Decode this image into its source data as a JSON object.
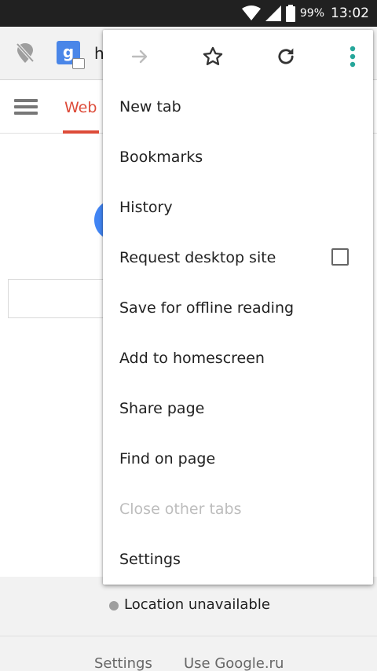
{
  "status_bar": {
    "battery_percent": "99%",
    "time": "13:02",
    "icons": [
      "wifi-icon",
      "signal-icon",
      "battery-icon"
    ]
  },
  "toolbar": {
    "url_partial": "h",
    "favicon_letter": "g",
    "icons": [
      "location-off-icon",
      "google-favicon-icon"
    ]
  },
  "page": {
    "tab_web": "Web",
    "location_text": "Location unavailable",
    "footer_links": [
      "Settings",
      "Use Google.ru"
    ]
  },
  "menu": {
    "toolbar_icons": [
      "forward-icon",
      "bookmark-star-icon",
      "reload-icon",
      "more-vert-icon"
    ],
    "items": [
      {
        "label": "New tab",
        "enabled": true
      },
      {
        "label": "Bookmarks",
        "enabled": true
      },
      {
        "label": "History",
        "enabled": true
      },
      {
        "label": "Request desktop site",
        "enabled": true,
        "checkbox": false
      },
      {
        "label": "Save for offline reading",
        "enabled": true
      },
      {
        "label": "Add to homescreen",
        "enabled": true
      },
      {
        "label": "Share page",
        "enabled": true
      },
      {
        "label": "Find on page",
        "enabled": true
      },
      {
        "label": "Close other tabs",
        "enabled": false
      },
      {
        "label": "Settings",
        "enabled": true
      }
    ]
  },
  "colors": {
    "accent_red": "#dd4b39",
    "more_icon_teal": "#26a69a",
    "disabled_text": "#bdbdbd"
  }
}
